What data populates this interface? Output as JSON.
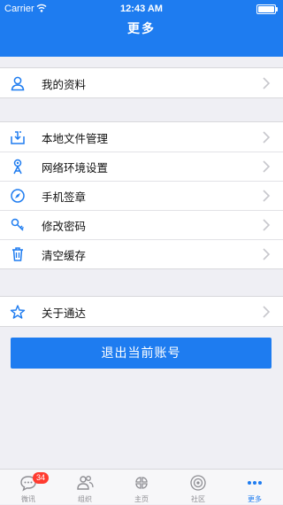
{
  "status_bar": {
    "carrier": "Carrier",
    "time": "12:43 AM",
    "battery_level": 1.0
  },
  "nav": {
    "title": "更多"
  },
  "groups": [
    {
      "items": [
        {
          "label": "我的资料",
          "icon": "user-icon"
        }
      ]
    },
    {
      "items": [
        {
          "label": "本地文件管理",
          "icon": "download-tray-icon"
        },
        {
          "label": "网络环境设置",
          "icon": "network-tower-icon"
        },
        {
          "label": "手机签章",
          "icon": "compass-icon"
        },
        {
          "label": "修改密码",
          "icon": "key-icon"
        },
        {
          "label": "清空缓存",
          "icon": "trash-icon"
        }
      ]
    },
    {
      "items": [
        {
          "label": "关于通达",
          "icon": "star-icon"
        }
      ]
    }
  ],
  "logout_label": "退出当前账号",
  "tabbar": {
    "tabs": [
      {
        "label": "微讯",
        "icon": "chat-bubble-icon",
        "badge": "34"
      },
      {
        "label": "组织",
        "icon": "people-icon"
      },
      {
        "label": "主页",
        "icon": "grid-petals-icon"
      },
      {
        "label": "社区",
        "icon": "community-ring-icon"
      },
      {
        "label": "更多",
        "icon": "more-dots-icon",
        "active": true
      }
    ]
  },
  "colors": {
    "primary": "#1e7cf0",
    "background": "#efeff4",
    "badge": "#ff3b30",
    "inactive_tab": "#8e8e93"
  }
}
